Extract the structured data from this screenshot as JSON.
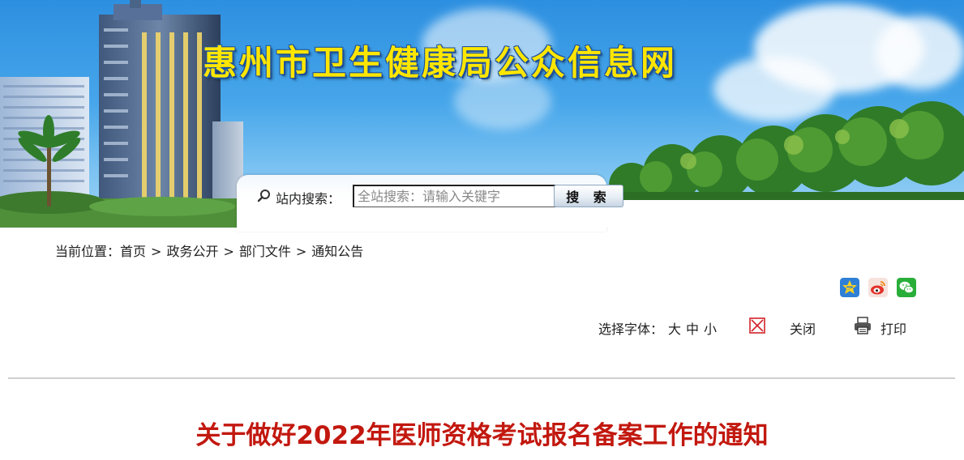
{
  "header": {
    "site_title": "惠州市卫生健康局公众信息网",
    "brand_color": "#ffe600"
  },
  "search": {
    "label": "站内搜索：",
    "placeholder": "全站搜索：请输入关键字",
    "value": "",
    "button_label": "搜 索",
    "icon": "magnifier-icon"
  },
  "breadcrumb": {
    "prefix": "当前位置：",
    "items": [
      "首页",
      "政务公开",
      "部门文件",
      "通知公告"
    ],
    "separator": ">"
  },
  "share": {
    "icons": [
      "qzone-icon",
      "weibo-icon",
      "wechat-icon"
    ]
  },
  "tools": {
    "font_label": "选择字体：",
    "sizes": [
      "大",
      "中",
      "小"
    ],
    "close_label": "关闭",
    "print_label": "打印"
  },
  "article": {
    "title": "关于做好2022年医师资格考试报名备案工作的通知",
    "title_color": "#c2180f"
  }
}
